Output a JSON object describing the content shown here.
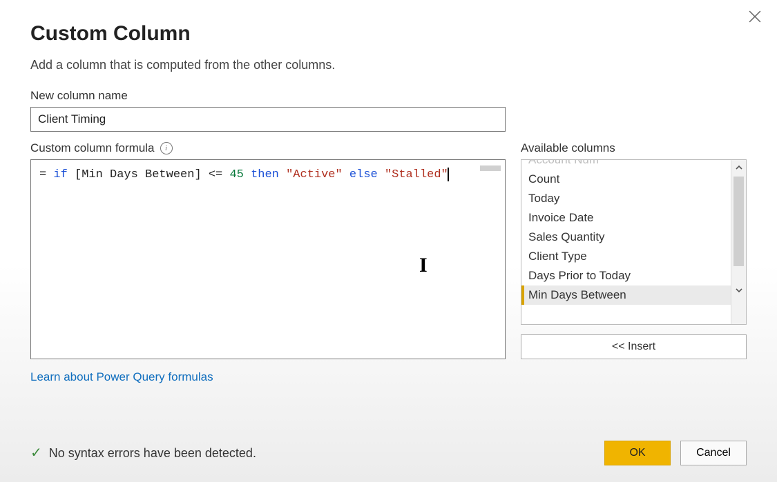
{
  "dialog": {
    "title": "Custom Column",
    "subtitle": "Add a column that is computed from the other columns.",
    "name_label": "New column name",
    "name_value": "Client Timing",
    "formula_label": "Custom column formula",
    "formula_tokens": {
      "eq": "=",
      "kw_if": "if",
      "col_ref": "[Min Days Between]",
      "op": "<=",
      "num": "45",
      "kw_then": "then",
      "str_active": "\"Active\"",
      "kw_else": "else",
      "str_stalled": "\"Stalled\""
    },
    "available_label": "Available columns",
    "available_columns_partial": "Account Num",
    "available_columns": [
      "Count",
      "Today",
      "Invoice Date",
      "Sales Quantity",
      "Client Type",
      "Days Prior to Today",
      "Min Days Between"
    ],
    "selected_column_index": 6,
    "insert_label": "<< Insert",
    "learn_link": "Learn about Power Query formulas",
    "status_text": "No syntax errors have been detected.",
    "ok_label": "OK",
    "cancel_label": "Cancel"
  }
}
